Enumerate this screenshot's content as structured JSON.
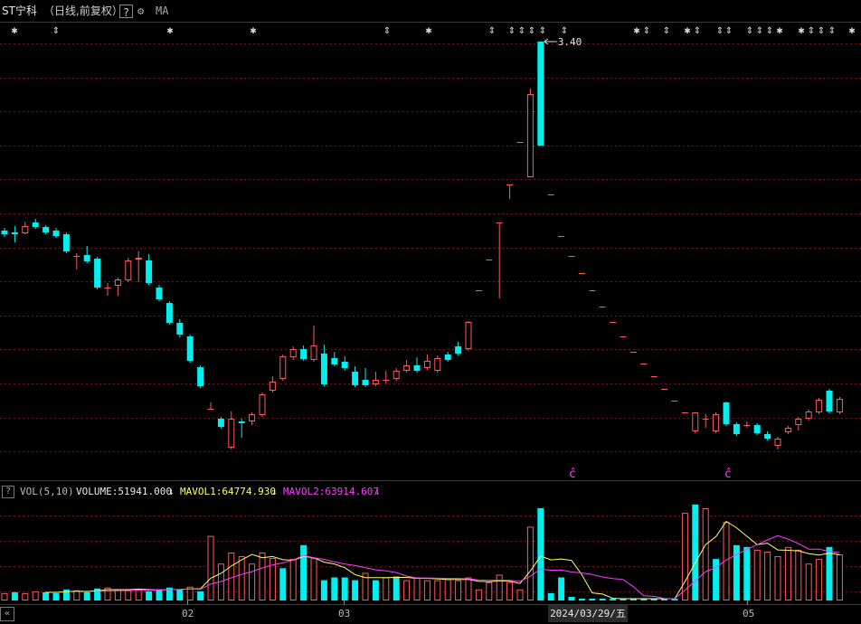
{
  "header": {
    "stock_name": "ST宁科",
    "period": "（日线,前复权）",
    "help": "?",
    "indicator": "MA"
  },
  "price_panel": {
    "high_label": "3.40",
    "event_marker": "ĉ"
  },
  "volume_panel": {
    "help": "?",
    "name": "VOL(5,10)",
    "volume": "VOLUME:51941.000",
    "mavol1": "MAVOL1:64774.930",
    "mavol2": "MAVOL2:63914.607",
    "arrow": "↓"
  },
  "axis": {
    "months": [
      "02",
      "03",
      "05"
    ],
    "cursor_date": "2024/03/29/五"
  },
  "colors": {
    "up": "#ff5a5a",
    "down": "#00f0f0",
    "ma1": "#ffff66",
    "ma2": "#ff3cff",
    "grid": "#7a1414"
  },
  "chart_data": {
    "type": "candlestick",
    "high_value": 3.4,
    "candles": [
      {
        "o": 255,
        "c": 259,
        "h": 252,
        "l": 262
      },
      {
        "o": 257,
        "c": 259,
        "h": 250,
        "l": 268
      },
      {
        "o": 258,
        "c": 250,
        "h": 245,
        "l": 259
      },
      {
        "o": 246,
        "c": 251,
        "h": 242,
        "l": 253
      },
      {
        "o": 251,
        "c": 257,
        "h": 249,
        "l": 259
      },
      {
        "o": 255,
        "c": 261,
        "h": 252,
        "l": 263
      },
      {
        "o": 259,
        "c": 278,
        "h": 257,
        "l": 280
      },
      {
        "o": 283,
        "c": 283,
        "h": 280,
        "l": 298
      },
      {
        "o": 282,
        "c": 289,
        "h": 272,
        "l": 291
      },
      {
        "o": 286,
        "c": 318,
        "h": 284,
        "l": 320
      },
      {
        "o": 318,
        "c": 318,
        "h": 313,
        "l": 327
      },
      {
        "o": 316,
        "c": 309,
        "h": 307,
        "l": 327
      },
      {
        "o": 310,
        "c": 288,
        "h": 285,
        "l": 312
      },
      {
        "o": 287,
        "c": 285,
        "h": 278,
        "l": 312
      },
      {
        "o": 288,
        "c": 313,
        "h": 281,
        "l": 315
      },
      {
        "o": 318,
        "c": 331,
        "h": 315,
        "l": 333
      },
      {
        "o": 335,
        "c": 357,
        "h": 333,
        "l": 359
      },
      {
        "o": 357,
        "c": 370,
        "h": 353,
        "l": 373
      },
      {
        "o": 372,
        "c": 399,
        "h": 370,
        "l": 401
      },
      {
        "o": 406,
        "c": 427,
        "h": 404,
        "l": 429
      },
      {
        "o": 452,
        "c": 452,
        "h": 445,
        "l": 452
      },
      {
        "o": 463,
        "c": 472,
        "h": 461,
        "l": 474
      },
      {
        "o": 495,
        "c": 463,
        "h": 455,
        "l": 497
      },
      {
        "o": 466,
        "c": 468,
        "h": 463,
        "l": 484
      },
      {
        "o": 466,
        "c": 458,
        "h": 456,
        "l": 470
      },
      {
        "o": 459,
        "c": 436,
        "h": 434,
        "l": 461
      },
      {
        "o": 432,
        "c": 422,
        "h": 416,
        "l": 434
      },
      {
        "o": 419,
        "c": 394,
        "h": 392,
        "l": 421
      },
      {
        "o": 395,
        "c": 386,
        "h": 383,
        "l": 398
      },
      {
        "o": 386,
        "c": 397,
        "h": 382,
        "l": 399
      },
      {
        "o": 398,
        "c": 382,
        "h": 360,
        "l": 400
      },
      {
        "o": 391,
        "c": 425,
        "h": 381,
        "l": 427
      },
      {
        "o": 396,
        "c": 403,
        "h": 389,
        "l": 405
      },
      {
        "o": 400,
        "c": 407,
        "h": 394,
        "l": 410
      },
      {
        "o": 411,
        "c": 426,
        "h": 405,
        "l": 428
      },
      {
        "o": 420,
        "c": 426,
        "h": 407,
        "l": 428
      },
      {
        "o": 425,
        "c": 420,
        "h": 411,
        "l": 427
      },
      {
        "o": 420,
        "c": 420,
        "h": 410,
        "l": 424
      },
      {
        "o": 419,
        "c": 410,
        "h": 407,
        "l": 421
      },
      {
        "o": 410,
        "c": 404,
        "h": 398,
        "l": 412
      },
      {
        "o": 404,
        "c": 410,
        "h": 395,
        "l": 412
      },
      {
        "o": 407,
        "c": 399,
        "h": 392,
        "l": 409
      },
      {
        "o": 410,
        "c": 396,
        "h": 393,
        "l": 412
      },
      {
        "o": 392,
        "c": 398,
        "h": 389,
        "l": 400
      },
      {
        "o": 383,
        "c": 391,
        "h": 378,
        "l": 393
      },
      {
        "o": 386,
        "c": 356,
        "h": 355,
        "l": 388
      },
      {
        "o": 321,
        "c": 321,
        "h": 321,
        "l": 321
      },
      {
        "o": 287,
        "c": 287,
        "h": 287,
        "l": 287
      },
      {
        "o": 246,
        "c": 246,
        "h": 246,
        "l": 330
      },
      {
        "o": 204,
        "c": 204,
        "h": 204,
        "l": 220
      },
      {
        "o": 157,
        "c": 157,
        "h": 157,
        "l": 157
      },
      {
        "o": 196,
        "c": 104,
        "h": 98,
        "l": 196
      },
      {
        "o": 46,
        "c": 161,
        "h": 46,
        "l": 161
      },
      {
        "o": 215,
        "c": 215,
        "h": 215,
        "l": 215
      },
      {
        "o": 261,
        "c": 261,
        "h": 261,
        "l": 261
      },
      {
        "o": 283,
        "c": 283,
        "h": 283,
        "l": 283
      },
      {
        "o": 302,
        "c": 302,
        "h": 302,
        "l": 302
      },
      {
        "o": 321,
        "c": 321,
        "h": 321,
        "l": 321
      },
      {
        "o": 339,
        "c": 339,
        "h": 339,
        "l": 339
      },
      {
        "o": 356,
        "c": 356,
        "h": 356,
        "l": 356
      },
      {
        "o": 372,
        "c": 372,
        "h": 372,
        "l": 372
      },
      {
        "o": 389,
        "c": 389,
        "h": 389,
        "l": 389
      },
      {
        "o": 402,
        "c": 402,
        "h": 402,
        "l": 402
      },
      {
        "o": 416,
        "c": 416,
        "h": 416,
        "l": 416
      },
      {
        "o": 430,
        "c": 430,
        "h": 430,
        "l": 430
      },
      {
        "o": 443,
        "c": 443,
        "h": 443,
        "l": 443
      },
      {
        "o": 456,
        "c": 456,
        "h": 456,
        "l": 456
      },
      {
        "o": 477,
        "c": 456,
        "h": 456,
        "l": 479
      },
      {
        "o": 463,
        "c": 463,
        "h": 458,
        "l": 473
      },
      {
        "o": 477,
        "c": 458,
        "h": 456,
        "l": 479
      },
      {
        "o": 445,
        "c": 469,
        "h": 444,
        "l": 471
      },
      {
        "o": 469,
        "c": 480,
        "h": 467,
        "l": 482
      },
      {
        "o": 470,
        "c": 470,
        "h": 466,
        "l": 473
      },
      {
        "o": 470,
        "c": 479,
        "h": 468,
        "l": 481
      },
      {
        "o": 480,
        "c": 485,
        "h": 477,
        "l": 487
      },
      {
        "o": 493,
        "c": 485,
        "h": 483,
        "l": 497
      },
      {
        "o": 478,
        "c": 473,
        "h": 471,
        "l": 480
      },
      {
        "o": 470,
        "c": 463,
        "h": 461,
        "l": 476
      },
      {
        "o": 463,
        "c": 455,
        "h": 453,
        "l": 465
      },
      {
        "o": 456,
        "c": 442,
        "h": 440,
        "l": 458
      },
      {
        "o": 432,
        "c": 455,
        "h": 430,
        "l": 457
      },
      {
        "o": 456,
        "c": 441,
        "h": 439,
        "l": 458
      }
    ],
    "volumes": [
      {
        "v": 8,
        "u": 1
      },
      {
        "v": 9,
        "u": 0
      },
      {
        "v": 8,
        "u": 1
      },
      {
        "v": 10,
        "u": 1
      },
      {
        "v": 9,
        "u": 0
      },
      {
        "v": 8,
        "u": 0
      },
      {
        "v": 12,
        "u": 0
      },
      {
        "v": 11,
        "u": 1
      },
      {
        "v": 9,
        "u": 0
      },
      {
        "v": 13,
        "u": 0
      },
      {
        "v": 14,
        "u": 1
      },
      {
        "v": 12,
        "u": 1
      },
      {
        "v": 11,
        "u": 1
      },
      {
        "v": 12,
        "u": 1
      },
      {
        "v": 10,
        "u": 0
      },
      {
        "v": 12,
        "u": 0
      },
      {
        "v": 14,
        "u": 0
      },
      {
        "v": 12,
        "u": 0
      },
      {
        "v": 15,
        "u": 1
      },
      {
        "v": 10,
        "u": 0
      },
      {
        "v": 70,
        "u": 1
      },
      {
        "v": 40,
        "u": 1
      },
      {
        "v": 52,
        "u": 1
      },
      {
        "v": 48,
        "u": 1
      },
      {
        "v": 40,
        "u": 1
      },
      {
        "v": 52,
        "u": 1
      },
      {
        "v": 46,
        "u": 1
      },
      {
        "v": 35,
        "u": 0
      },
      {
        "v": 45,
        "u": 1
      },
      {
        "v": 60,
        "u": 0
      },
      {
        "v": 46,
        "u": 1
      },
      {
        "v": 22,
        "u": 0
      },
      {
        "v": 25,
        "u": 0
      },
      {
        "v": 25,
        "u": 0
      },
      {
        "v": 22,
        "u": 0
      },
      {
        "v": 30,
        "u": 1
      },
      {
        "v": 22,
        "u": 0
      },
      {
        "v": 25,
        "u": 1
      },
      {
        "v": 26,
        "u": 0
      },
      {
        "v": 22,
        "u": 1
      },
      {
        "v": 25,
        "u": 1
      },
      {
        "v": 22,
        "u": 1
      },
      {
        "v": 22,
        "u": 1
      },
      {
        "v": 23,
        "u": 1
      },
      {
        "v": 22,
        "u": 1
      },
      {
        "v": 25,
        "u": 1
      },
      {
        "v": 12,
        "u": 1
      },
      {
        "v": 20,
        "u": 1
      },
      {
        "v": 28,
        "u": 1
      },
      {
        "v": 20,
        "u": 1
      },
      {
        "v": 12,
        "u": 1
      },
      {
        "v": 80,
        "u": 1
      },
      {
        "v": 100,
        "u": 0
      },
      {
        "v": 8,
        "u": 0
      },
      {
        "v": 25,
        "u": 0
      },
      {
        "v": 4,
        "u": 0
      },
      {
        "v": 2,
        "u": 0
      },
      {
        "v": 2,
        "u": 0
      },
      {
        "v": 2,
        "u": 0
      },
      {
        "v": 2,
        "u": 0
      },
      {
        "v": 2,
        "u": 0
      },
      {
        "v": 2,
        "u": 0
      },
      {
        "v": 2,
        "u": 0
      },
      {
        "v": 2,
        "u": 0
      },
      {
        "v": 2,
        "u": 0
      },
      {
        "v": 2,
        "u": 0
      },
      {
        "v": 95,
        "u": 1
      },
      {
        "v": 104,
        "u": 0
      },
      {
        "v": 100,
        "u": 1
      },
      {
        "v": 45,
        "u": 0
      },
      {
        "v": 85,
        "u": 1
      },
      {
        "v": 60,
        "u": 0
      },
      {
        "v": 58,
        "u": 0
      },
      {
        "v": 55,
        "u": 1
      },
      {
        "v": 53,
        "u": 1
      },
      {
        "v": 48,
        "u": 1
      },
      {
        "v": 58,
        "u": 1
      },
      {
        "v": 55,
        "u": 1
      },
      {
        "v": 40,
        "u": 1
      },
      {
        "v": 45,
        "u": 1
      },
      {
        "v": 58,
        "u": 0
      },
      {
        "v": 50,
        "u": 1
      }
    ]
  }
}
